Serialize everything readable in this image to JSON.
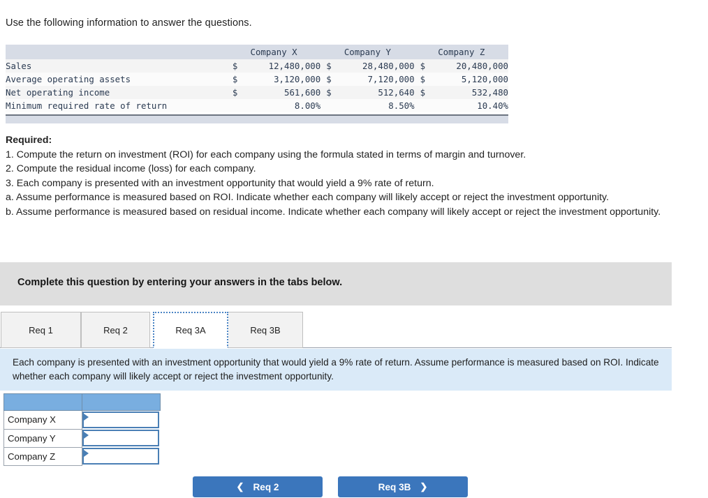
{
  "intro": "Use the following information to answer the questions.",
  "facts_table": {
    "columns": [
      "",
      "Company X",
      "Company Y",
      "Company Z"
    ],
    "rows": [
      {
        "label": "Sales",
        "x_cur": "$",
        "x": "12,480,000",
        "y_cur": "$",
        "y": "28,480,000",
        "z_cur": "$",
        "z": "20,480,000"
      },
      {
        "label": "Average operating assets",
        "x_cur": "$",
        "x": "3,120,000",
        "y_cur": "$",
        "y": "7,120,000",
        "z_cur": "$",
        "z": "5,120,000"
      },
      {
        "label": "Net operating income",
        "x_cur": "$",
        "x": "561,600",
        "y_cur": "$",
        "y": "512,640",
        "z_cur": "$",
        "z": "532,480"
      },
      {
        "label": "Minimum required rate of return",
        "x_cur": "",
        "x": "8.00%",
        "y_cur": "",
        "y": "8.50%",
        "z_cur": "",
        "z": "10.40%"
      }
    ]
  },
  "required": {
    "heading": "Required:",
    "lines": [
      "1. Compute the return on investment (ROI) for each company using the formula stated in terms of margin and turnover.",
      "2. Compute the residual income (loss) for each company.",
      "3. Each company is presented with an investment opportunity that would yield a 9% rate of return.",
      "a. Assume performance is measured based on ROI.  Indicate whether each company will likely accept or reject the investment opportunity.",
      "b. Assume performance is measured based on residual income. Indicate whether each company will likely accept or reject the investment opportunity."
    ]
  },
  "banner": {
    "text": "Complete this question by entering your answers in the tabs below."
  },
  "tabs": [
    {
      "label": "Req 1",
      "active": false
    },
    {
      "label": "Req 2",
      "active": false
    },
    {
      "label": "Req 3A",
      "active": true
    },
    {
      "label": "Req 3B",
      "active": false
    }
  ],
  "instruction_panel": {
    "text": "Each company is presented with an investment opportunity that would yield a 9% rate of return. Assume performance is measured based on ROI.  Indicate whether each company will likely accept or reject the investment opportunity."
  },
  "answer_table": {
    "header": [
      "",
      ""
    ],
    "rows": [
      {
        "name": "Company X",
        "value": ""
      },
      {
        "name": "Company Y",
        "value": ""
      },
      {
        "name": "Company Z",
        "value": ""
      }
    ]
  },
  "nav": {
    "prev_label": "Req 2",
    "prev_icon": "chevron-left",
    "next_label": "Req 3B",
    "next_icon": "chevron-right"
  },
  "colors": {
    "facts_header_bg": "#D7DCE6",
    "banner_bg": "#DEDEDE",
    "panel_bg": "#DAEAF8",
    "answer_header_bg": "#79AEE0",
    "button_blue": "#3B76BC",
    "tab_focus_border": "#4A84C4"
  }
}
